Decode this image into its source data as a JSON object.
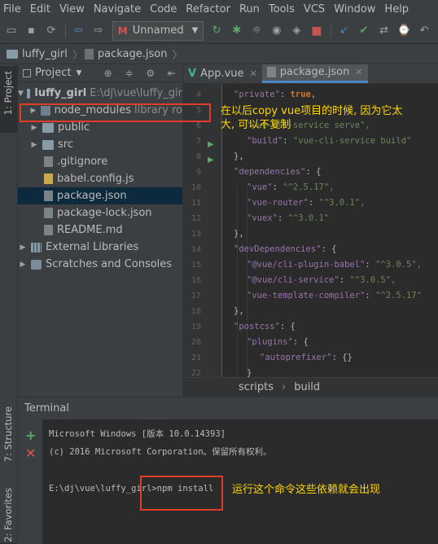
{
  "menu": [
    "File",
    "Edit",
    "View",
    "Navigate",
    "Code",
    "Refactor",
    "Run",
    "Tools",
    "VCS",
    "Window",
    "Help"
  ],
  "toolbar": {
    "run_config": "Unnamed",
    "run_config_icon": "M"
  },
  "navbar": {
    "project": "luffy_girl",
    "file": "package.json"
  },
  "side_tabs": {
    "project": "1: Project",
    "structure": "7: Structure",
    "favorites": "2: Favorites"
  },
  "project_panel": {
    "title": "Project",
    "root": {
      "name": "luffy_girl",
      "path": "E:\\dj\\vue\\luffy_gir"
    },
    "items": [
      {
        "label": "node_modules",
        "extra": "library ro"
      },
      {
        "label": "public"
      },
      {
        "label": "src"
      },
      {
        "label": ".gitignore"
      },
      {
        "label": "babel.config.js"
      },
      {
        "label": "package.json"
      },
      {
        "label": "package-lock.json"
      },
      {
        "label": "README.md"
      }
    ],
    "external": "External Libraries",
    "scratches": "Scratches and Consoles"
  },
  "editor": {
    "tabs": [
      "App.vue",
      "package.json"
    ],
    "breadcrumb": [
      "scripts",
      "build"
    ],
    "line_numbers": [
      "4",
      "5",
      "6",
      "7",
      "8",
      "9",
      "10",
      "11",
      "12",
      "13",
      "14",
      "15",
      "16",
      "17",
      "18",
      "19",
      "20",
      "21",
      "22"
    ],
    "code": {
      "l4_key": "\"private\"",
      "l4_val": "true",
      "l6_val": "\"vue-cli-service serve\",",
      "l7_key": "\"build\"",
      "l7_val": "\"vue-cli-service build\"",
      "l8": "},",
      "l9_key": "\"dependencies\"",
      "l9_rest": ": {",
      "l10_key": "\"vue\"",
      "l10_val": "\"^2.5.17\",",
      "l11_key": "\"vue-router\"",
      "l11_val": "\"^3.0.1\",",
      "l12_key": "\"vuex\"",
      "l12_val": "\"^3.0.1\"",
      "l13": "},",
      "l14_key": "\"devDependencies\"",
      "l14_rest": ": {",
      "l15_key": "\"@vue/cli-plugin-babel\"",
      "l15_val": "\"^3.0.5\",",
      "l16_key": "\"@vue/cli-service\"",
      "l16_val": "\"^3.0.5\",",
      "l17_key": "\"vue-template-compiler\"",
      "l17_val": "\"^2.5.17\"",
      "l18": "},",
      "l19_key": "\"postcss\"",
      "l19_rest": ": {",
      "l20_key": "\"plugins\"",
      "l20_rest": ": {",
      "l21_key": "\"autoprefixer\"",
      "l21_rest": ": {}",
      "l22": "}"
    }
  },
  "terminal": {
    "title": "Terminal",
    "lines": [
      "Microsoft Windows [版本 10.0.14393]",
      "(c) 2016 Microsoft Corporation。保留所有权利。",
      "E:\\dj\\vue\\luffy_girl>npm install"
    ]
  },
  "annotations": {
    "top_line1": "在以后copy vue项目的时候, 因为它太",
    "top_line2": "大, 可以不复制",
    "bottom": "运行这个命令这些依赖就会出现"
  },
  "colors": {
    "accent": "#4a88c7",
    "annotation": "#ffd700",
    "red_box": "#e03c2a",
    "selection": "#0d293e"
  }
}
